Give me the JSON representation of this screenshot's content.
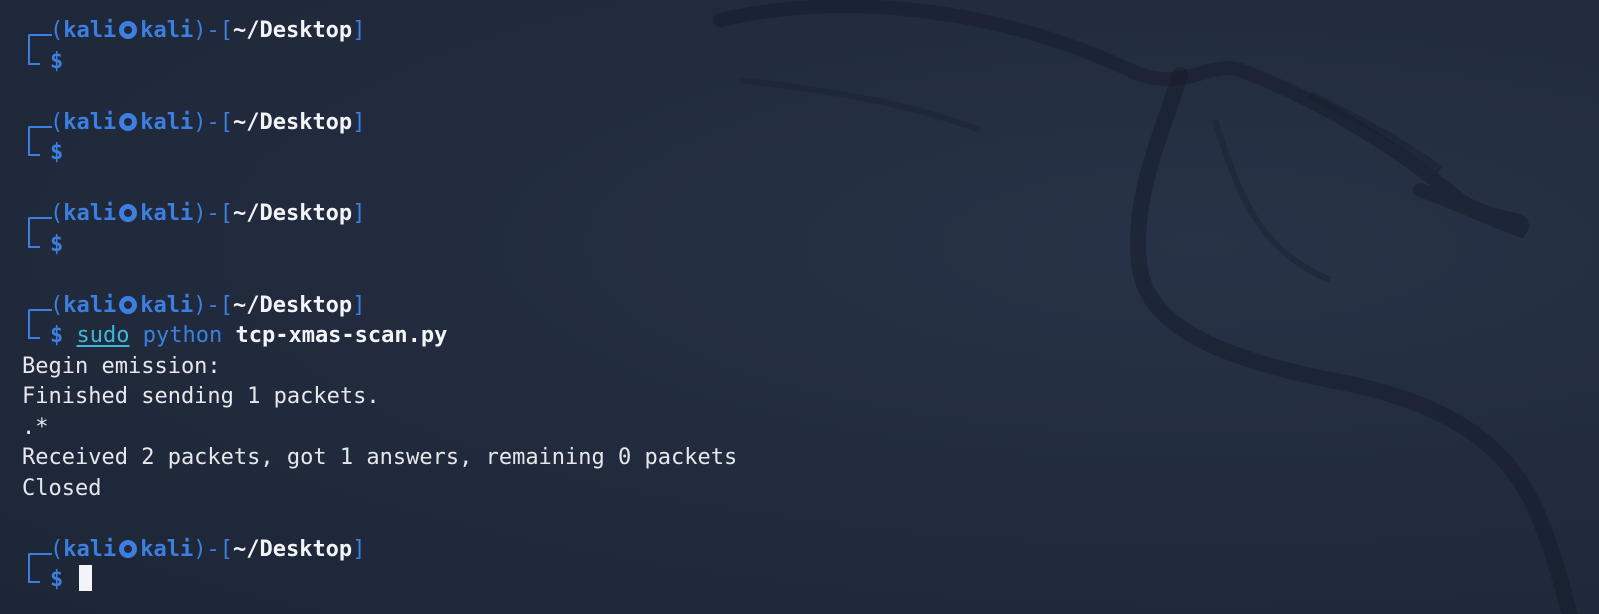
{
  "prompt": {
    "user": "kali",
    "host": "kali",
    "path": "~/Desktop",
    "open_paren": "(",
    "close_paren": ")",
    "sep": "-",
    "open_bracket": "[",
    "close_bracket": "]",
    "dollar": "$"
  },
  "command": {
    "sudo": "sudo",
    "program": "python",
    "argument": "tcp-xmas-scan.py"
  },
  "output": [
    "Begin emission:",
    "Finished sending 1 packets.",
    ".*",
    "Received 2 packets, got 1 answers, remaining 0 packets",
    "Closed"
  ],
  "colors": {
    "background": "#202a3c",
    "prompt_blue": "#3d7fe0",
    "text": "#e6e8ec",
    "sudo_cyan": "#3fb8d8"
  },
  "icons": {
    "at_symbol": "kali-skull-icon"
  }
}
